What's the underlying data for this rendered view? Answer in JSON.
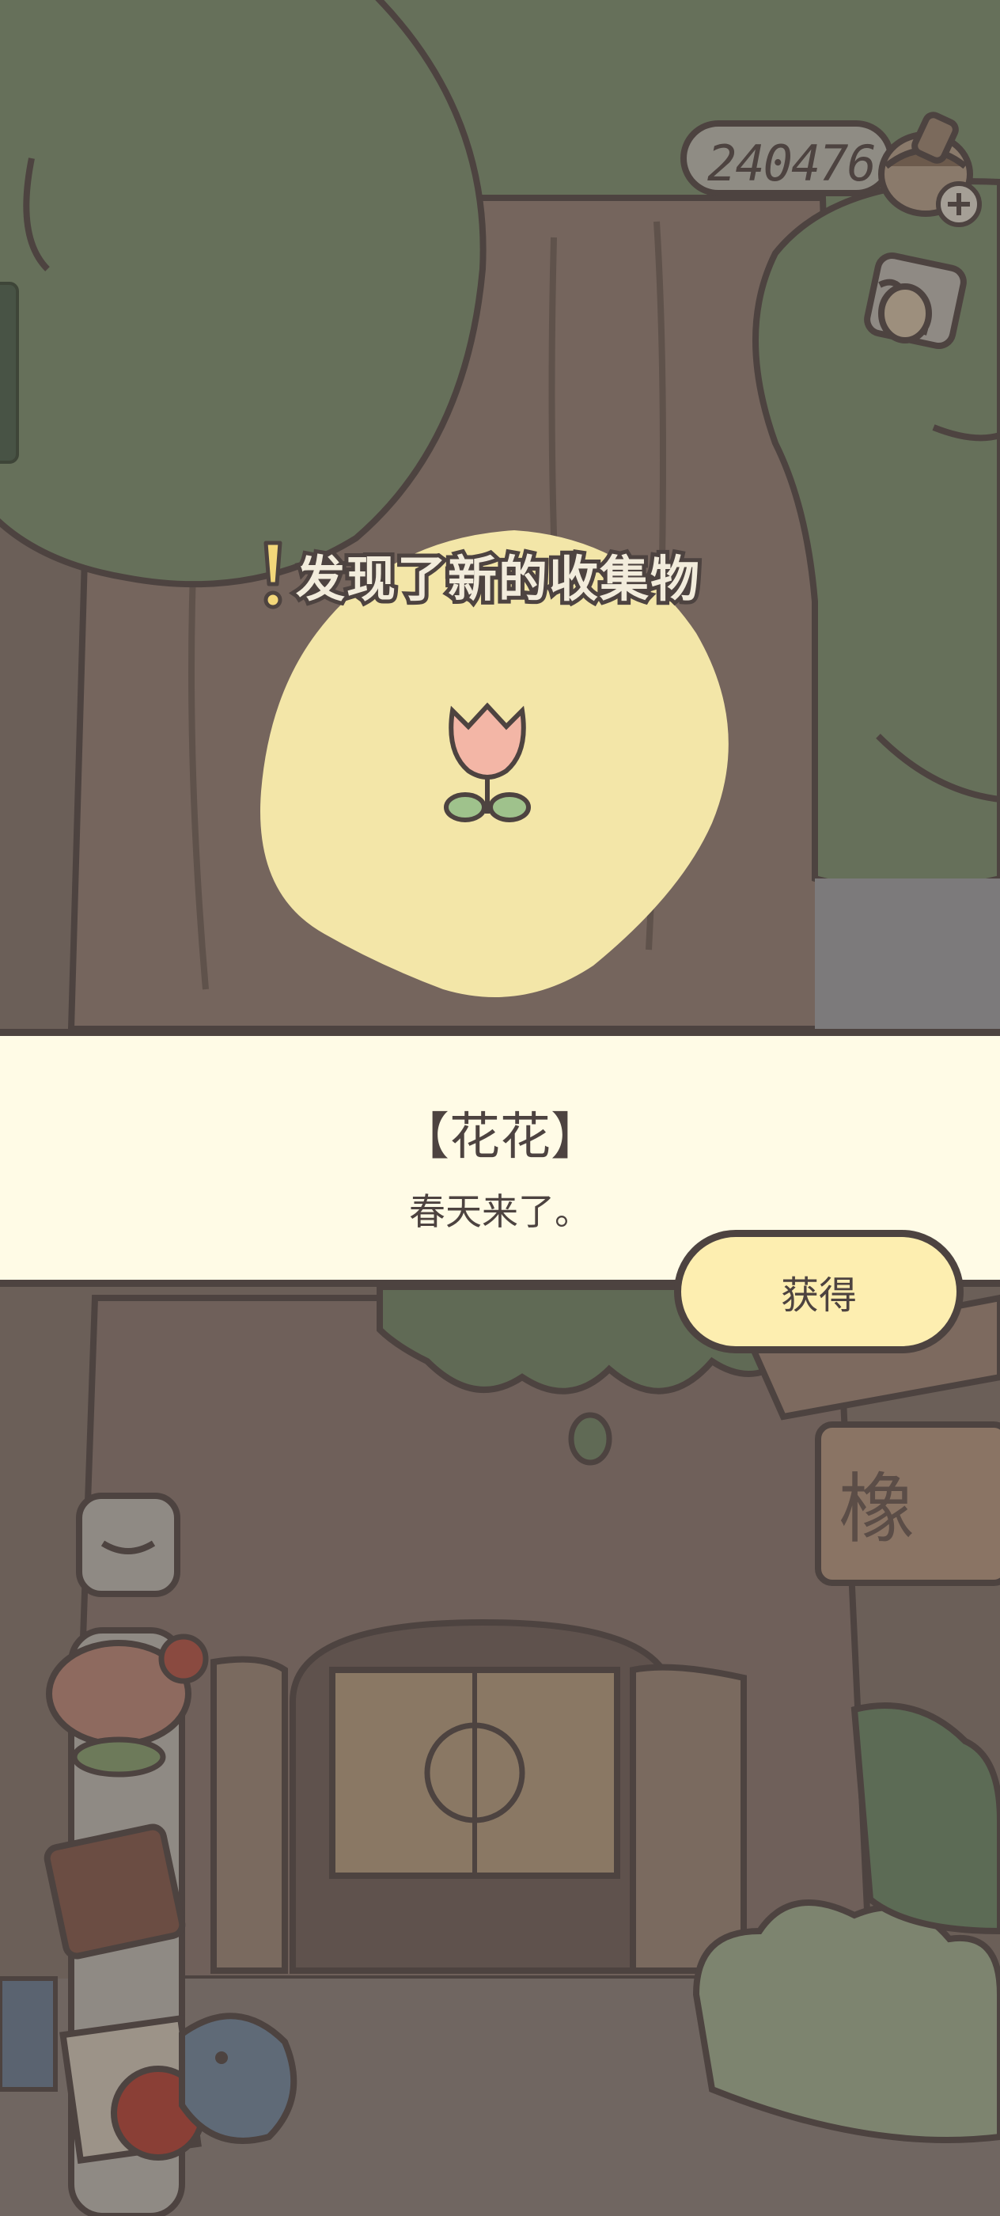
{
  "currency": {
    "amount": "240476",
    "icon": "acorn-plus-icon"
  },
  "mail": {
    "icon": "letter-icon"
  },
  "discovery": {
    "title": "发现了新的收集物",
    "icon": "exclamation-icon"
  },
  "item": {
    "name": "【花花】",
    "description": "春天来了。",
    "icon": "tulip-icon"
  },
  "actions": {
    "obtain_label": "获得"
  },
  "colors": {
    "outline": "#4d4340",
    "panel": "#fffbe6",
    "button": "#fdeeb0",
    "blob": "#f3e6a8",
    "foliage": "#66705a"
  }
}
